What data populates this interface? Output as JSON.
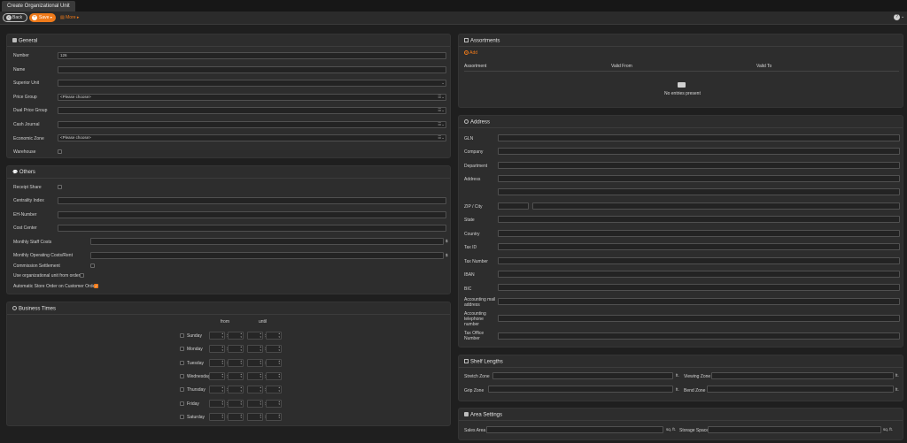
{
  "tab": {
    "title": "Create Organizational Unit"
  },
  "toolbar": {
    "back": "Back",
    "save": "Save",
    "more": "More",
    "help": "?"
  },
  "general": {
    "title": "General",
    "number_label": "Number",
    "number_value": "126",
    "name_label": "Name",
    "superior_label": "Superior Unit",
    "price_group_label": "Price Group",
    "price_group_value": "<Please choose>",
    "dual_price_label": "Dual Price Group",
    "cash_journal_label": "Cash Journal",
    "economic_zone_label": "Economic Zone",
    "economic_zone_value": "<Please choose>",
    "warehouse_label": "Warehouse"
  },
  "others": {
    "title": "Others",
    "receipt_share": "Receipt Share",
    "centrality": "Centrality Index",
    "eh_number": "EH-Number",
    "cost_center": "Cost Center",
    "staff_costs": "Monthly Staff Costs",
    "operating_costs": "Monthly Operating Costs/Rent",
    "currency": "$",
    "commission": "Commission Settlement",
    "use_org_unit": "Use organizational unit from order",
    "auto_store": "Automatic Store Order on Customer Order"
  },
  "business": {
    "title": "Business Times",
    "from": "from",
    "until": "until",
    "days": [
      "Sunday",
      "Monday",
      "Tuesday",
      "Wednesday",
      "Thursday",
      "Friday",
      "Saturday"
    ]
  },
  "assortments": {
    "title": "Assortments",
    "add": "Add",
    "col_assortment": "Assortment",
    "col_from": "Valid From",
    "col_to": "Valid To",
    "empty": "No entries present"
  },
  "address": {
    "title": "Address",
    "gln": "GLN",
    "company": "Company",
    "department": "Department",
    "address": "Address",
    "zip_city": "ZIP / City",
    "state": "State",
    "country": "Country",
    "tax_id": "Tax ID",
    "tax_number": "Tax Number",
    "iban": "IBAN",
    "bic": "BIC",
    "acc_mail_1": "Accounting mail",
    "acc_mail_2": "address",
    "acc_tel_1": "Accounting",
    "acc_tel_2": "telephone",
    "acc_tel_3": "number",
    "tax_office_1": "Tax Office",
    "tax_office_2": "Number"
  },
  "shelf": {
    "title": "Shelf Lengths",
    "stretch": "Stretch Zone",
    "viewing": "Viewing Zone",
    "grip": "Grip Zone",
    "bend": "Bend Zone",
    "unit": "ft."
  },
  "area": {
    "title": "Area Settings",
    "sales": "Sales Area",
    "storage": "Storage Space",
    "unit": "sq. ft."
  }
}
